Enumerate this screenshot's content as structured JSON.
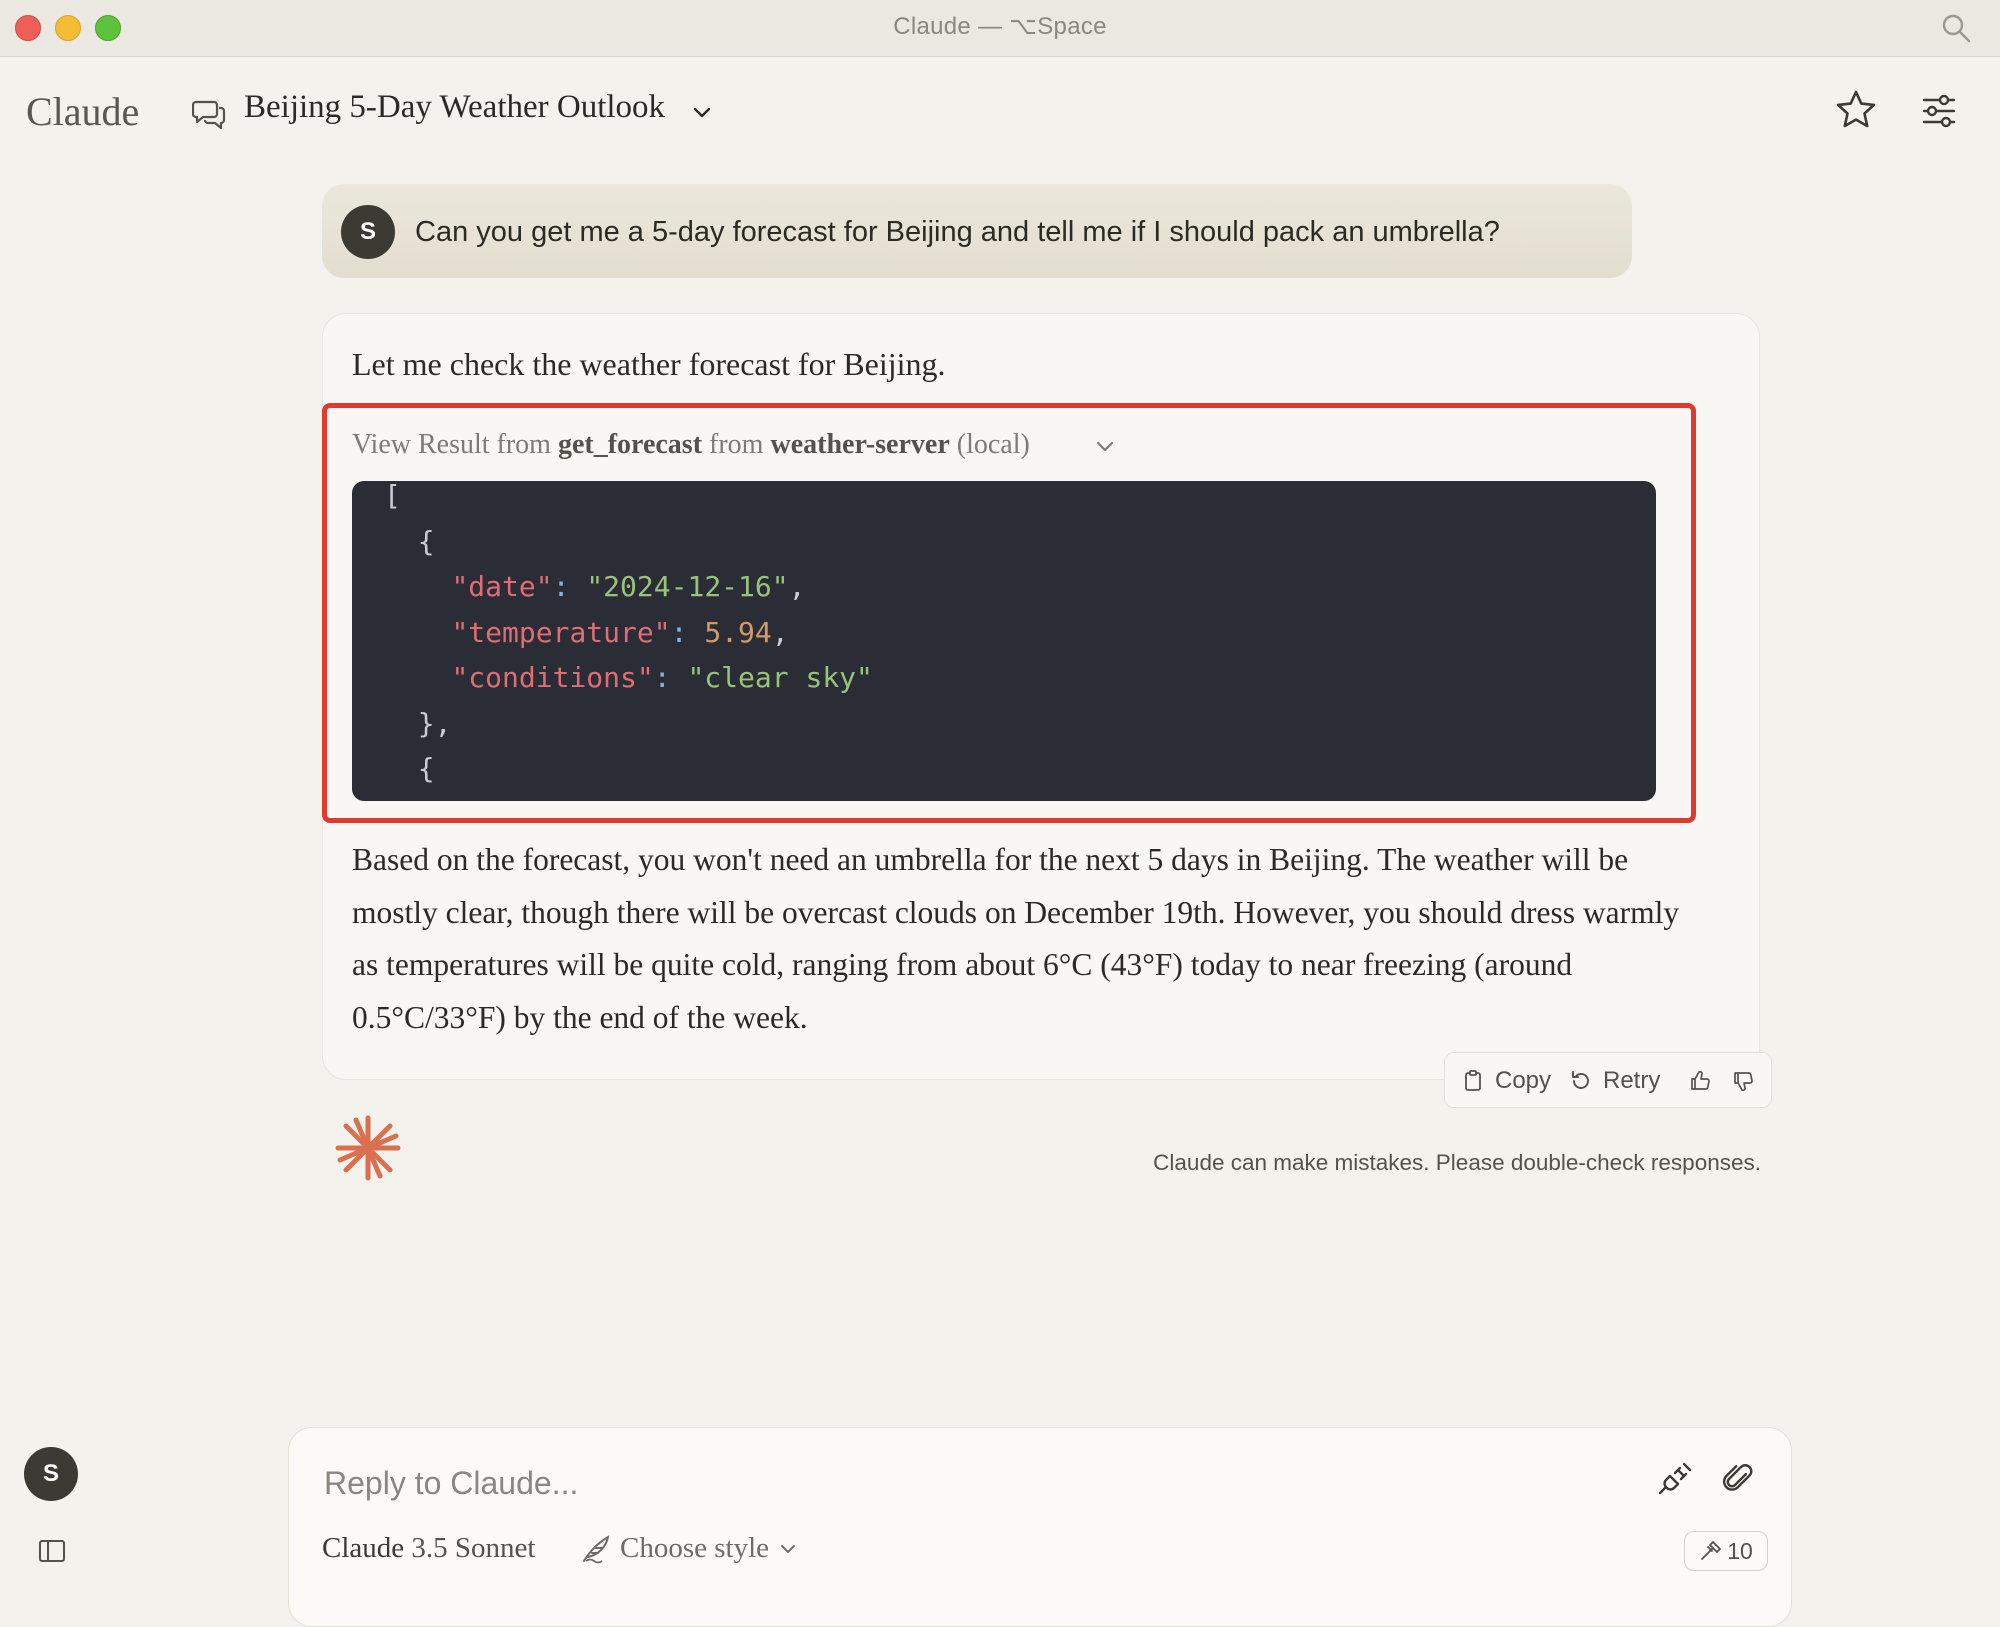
{
  "window": {
    "title": "Claude — ⌥Space"
  },
  "header": {
    "logo": "Claude",
    "conversation_title": "Beijing 5-Day Weather Outlook"
  },
  "user_message": {
    "avatar_initial": "S",
    "text": "Can you get me a 5-day forecast for Beijing and tell me if I should pack an umbrella?"
  },
  "assistant": {
    "intro": "Let me check the weather forecast for Beijing.",
    "tool_result": {
      "prefix": "View Result from",
      "tool_name": "get_forecast",
      "middle": "from",
      "server_name": "weather-server",
      "suffix": "(local)",
      "code": {
        "open_bracket": "[",
        "open_brace": "{",
        "date_key": "\"date\"",
        "date_value": "\"2024-12-16\"",
        "temperature_key": "\"temperature\"",
        "temperature_value": "5.94",
        "conditions_key": "\"conditions\"",
        "conditions_value": "\"clear sky\"",
        "close_brace": "},",
        "next_brace": "{"
      }
    },
    "answer": "Based on the forecast, you won't need an umbrella for the next 5 days in Beijing. The weather will be mostly clear, though there will be overcast clouds on December 19th. However, you should dress warmly as temperatures will be quite cold, ranging from about 6°C (43°F) today to near freezing (around 0.5°C/33°F) by the end of the week.",
    "actions": {
      "copy": "Copy",
      "retry": "Retry"
    }
  },
  "disclaimer": "Claude can make mistakes. Please double-check responses.",
  "sidebar": {
    "avatar_initial": "S"
  },
  "composer": {
    "placeholder": "Reply to Claude...",
    "model_brand": "Claude",
    "model_version": "3.5 Sonnet",
    "style_label": "Choose style",
    "tools_count": "10"
  },
  "colors": {
    "highlight_border": "#e03a2f",
    "code_background": "#2a2d36",
    "accent_burst": "#d9704f"
  }
}
